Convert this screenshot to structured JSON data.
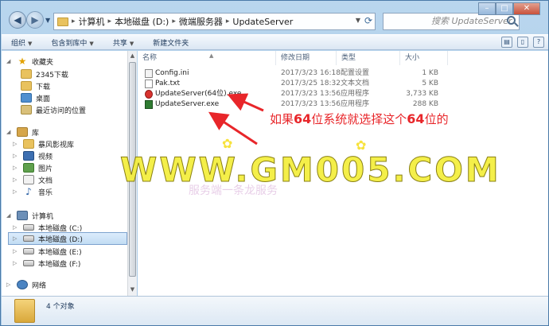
{
  "address": {
    "crumbs": [
      "计算机",
      "本地磁盘 (D:)",
      "微端服务器",
      "UpdateServer"
    ],
    "tabs": [
      "",
      "",
      ""
    ]
  },
  "search": {
    "placeholder": "搜索 UpdateServer"
  },
  "toolbar": {
    "organize": "组织",
    "include_library": "包含到库中",
    "share": "共享",
    "new_folder": "新建文件夹"
  },
  "nav": {
    "favorites": "收藏夹",
    "fav_items": [
      "2345下载",
      "下载",
      "桌面",
      "最近访问的位置"
    ],
    "libraries": "库",
    "lib_items": [
      "暴风影视库",
      "视频",
      "图片",
      "文档",
      "音乐"
    ],
    "computer": "计算机",
    "drives": [
      "本地磁盘 (C:)",
      "本地磁盘 (D:)",
      "本地磁盘 (E:)",
      "本地磁盘 (F:)"
    ],
    "network": "网络"
  },
  "columns": {
    "name": "名称",
    "date": "修改日期",
    "type": "类型",
    "size": "大小"
  },
  "files": [
    {
      "name": "Config.ini",
      "date": "2017/3/23 16:18",
      "type": "配置设置",
      "size": "1 KB"
    },
    {
      "name": "Pak.txt",
      "date": "2017/3/25 18:32",
      "type": "文本文档",
      "size": "5 KB"
    },
    {
      "name": "UpdateServer(64位).exe",
      "date": "2017/3/23 13:56",
      "type": "应用程序",
      "size": "3,733 KB"
    },
    {
      "name": "UpdateServer.exe",
      "date": "2017/3/23 13:56",
      "type": "应用程序",
      "size": "288 KB"
    }
  ],
  "annotation": {
    "prefix": "如果",
    "num1": "64",
    "middle": "位系统就选择这个",
    "num2": "64",
    "suffix": "位的"
  },
  "watermark": {
    "main": "WWW.GM005.COM",
    "sub": "服务端一条龙服务"
  },
  "status": {
    "count": "4 个对象"
  },
  "colors": {
    "annotation": "#e8262a",
    "watermark": "#f4ee3a"
  }
}
